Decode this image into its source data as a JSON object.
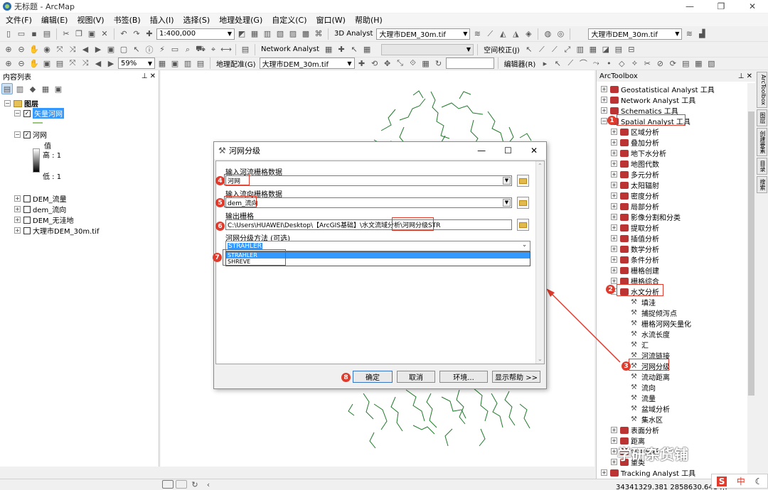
{
  "window": {
    "title": "无标题 - ArcMap"
  },
  "menu": [
    "文件(F)",
    "编辑(E)",
    "视图(V)",
    "书签(B)",
    "插入(I)",
    "选择(S)",
    "地理处理(G)",
    "自定义(C)",
    "窗口(W)",
    "帮助(H)"
  ],
  "toolbar": {
    "scale": "1:400,000",
    "analyst3d": "3D Analyst",
    "layer_combo_1": "大理市DEM_30m.tif",
    "layer_combo_2": "大理市DEM_30m.tif",
    "network_analyst": "Network Analyst",
    "spatial_adjust": "空间校正(J)",
    "zoom_percent": "59%",
    "georef_label": "地理配准(G)",
    "georef_layer": "大理市DEM_30m.tif",
    "editor": "编辑器(R)"
  },
  "toc": {
    "title": "内容列表",
    "group": "图层",
    "layers": [
      {
        "name": "矢量河网",
        "checked": true,
        "selected": true
      },
      {
        "name": "河网",
        "checked": true
      },
      {
        "name": "DEM_流量",
        "checked": false
      },
      {
        "name": "dem_流向",
        "checked": false
      },
      {
        "name": "DEM_无洼地",
        "checked": false
      },
      {
        "name": "大理市DEM_30m.tif",
        "checked": false
      }
    ],
    "legend": {
      "value_label": "值",
      "high": "高 : 1",
      "low": "低 : 1"
    }
  },
  "toolbox": {
    "title": "ArcToolbox",
    "top_items": [
      "Geostatistical Analyst 工具",
      "Network Analyst 工具",
      "Schematics 工具",
      "Spatial Analyst 工具"
    ],
    "spatial_children": [
      "区域分析",
      "叠加分析",
      "地下水分析",
      "地图代数",
      "多元分析",
      "太阳辐射",
      "密度分析",
      "局部分析",
      "影像分割和分类",
      "提取分析",
      "插值分析",
      "数学分析",
      "条件分析",
      "栅格创建",
      "栅格综合",
      "水文分析"
    ],
    "hydro_tools": [
      "填洼",
      "捕捉倾泻点",
      "栅格河网矢量化",
      "水流长度",
      "汇",
      "河流链接",
      "河网分级",
      "流动距离",
      "流向",
      "流量",
      "盆域分析",
      "集水区"
    ],
    "after_items": [
      "表面分析",
      "距离",
      "邻域分析",
      "重类"
    ],
    "bottom_item": "Tracking Analyst 工具"
  },
  "side_tabs": [
    "ArcToolbox",
    "图层",
    "创建要素",
    "目录",
    "搜索"
  ],
  "dialog": {
    "title": "河网分级",
    "label_input_stream": "输入河流栅格数据",
    "input_stream": "河网",
    "label_input_dir": "输入流向栅格数据",
    "input_dir": "dem_流向",
    "label_output": "输出栅格",
    "output_path": "C:\\Users\\HUAWEI\\Desktop\\【ArcGIS基础】\\水文流域分析\\河网分级STR",
    "label_method": "河网分级方法 (可选)",
    "method_value": "STRAHLER",
    "method_options": [
      "STRAHLER",
      "SHREVE"
    ],
    "btn_ok": "确定",
    "btn_cancel": "取消",
    "btn_env": "环境...",
    "btn_help": "显示帮助 >>"
  },
  "badges": [
    "1",
    "2",
    "3",
    "4",
    "5",
    "6",
    "7",
    "8"
  ],
  "status": {
    "coords": "34341329.381  2858630.641 米"
  },
  "watermark": "学研杂货铺",
  "colors": {
    "accent_red": "#e03b2c",
    "river_green": "#1f7a2a",
    "selection_blue": "#3399ff"
  }
}
